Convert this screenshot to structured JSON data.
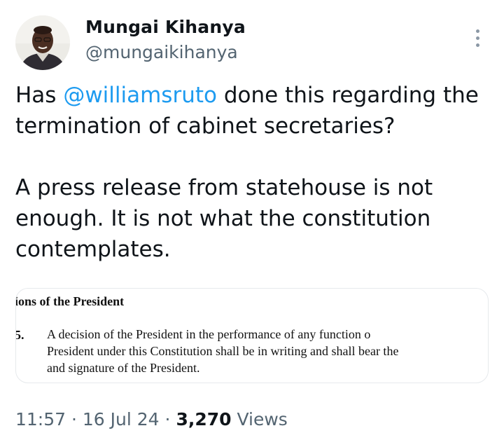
{
  "tweet": {
    "author": {
      "display_name": "Mungai Kihanya",
      "handle": "@mungaikihanya",
      "avatar": "profile-photo"
    },
    "text_before_mention": "Has ",
    "mention": "@williamsruto",
    "text_after_mention": " done this regarding the\ntermination of cabinet secretaries?\n\nA press release from statehouse is not\nenough. It is not what the constitution\ncontemplates.",
    "media": {
      "heading": "ions of the President",
      "clause_number": "5.",
      "clause_text": "A decision of the President in the performance of any function o\nPresident under this Constitution shall be in writing and shall bear the\nand signature of the President."
    },
    "time": "11:57",
    "separator": "·",
    "date": "16 Jul 24",
    "views_count": "3,270",
    "views_label": "Views"
  },
  "icons": {
    "more": "more-vertical-icon"
  },
  "colors": {
    "link": "#1d9bf0",
    "secondary_text": "#536471",
    "primary_text": "#0f1419",
    "card_border": "#e6e9ec"
  }
}
